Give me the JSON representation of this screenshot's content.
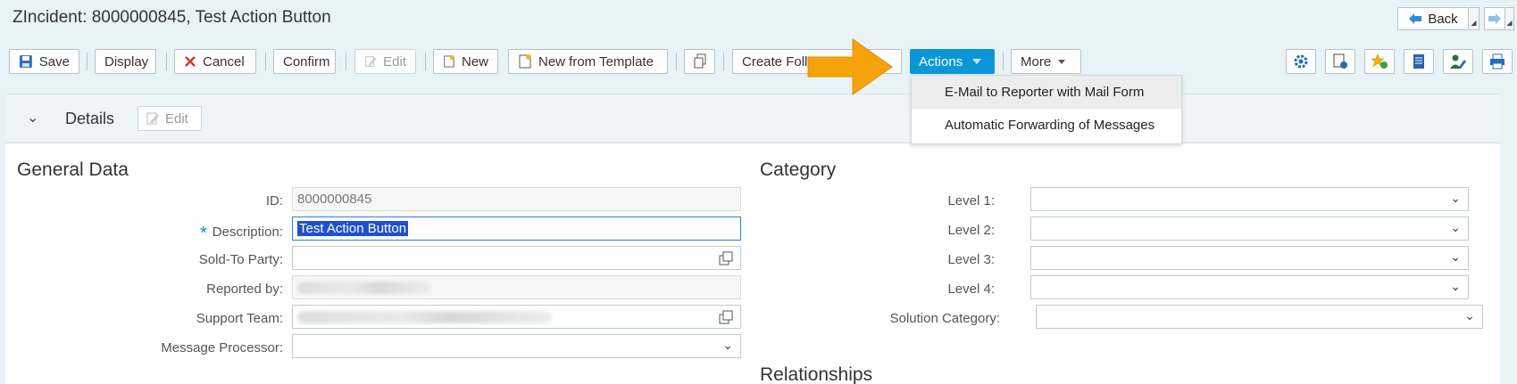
{
  "header": {
    "title": "ZIncident: 8000000845, Test Action Button",
    "back_label": "Back"
  },
  "toolbar": {
    "save": "Save",
    "display": "Display",
    "cancel": "Cancel",
    "confirm": "Confirm",
    "edit": "Edit",
    "new": "New",
    "new_from_template": "New from Template",
    "create_follow_up": "Create Foll",
    "actions": "Actions",
    "more": "More"
  },
  "actions_menu": {
    "items": [
      {
        "label": "E-Mail to Reporter with Mail Form"
      },
      {
        "label": "Automatic Forwarding of Messages"
      }
    ]
  },
  "details": {
    "title": "Details",
    "edit": "Edit"
  },
  "general_data": {
    "title": "General Data",
    "id_label": "ID:",
    "id_value": "8000000845",
    "description_label": "Description:",
    "description_value": "Test Action Button",
    "sold_to_label": "Sold-To Party:",
    "reported_by_label": "Reported by:",
    "support_team_label": "Support Team:",
    "message_processor_label": "Message Processor:"
  },
  "category": {
    "title": "Category",
    "level1_label": "Level 1:",
    "level2_label": "Level 2:",
    "level3_label": "Level 3:",
    "level4_label": "Level 4:",
    "solution_label": "Solution Category:"
  },
  "relationships": {
    "title": "Relationships"
  },
  "colors": {
    "accent": "#0a97d8",
    "arrow": "#f5a30a",
    "required": "#0a8ccf"
  }
}
